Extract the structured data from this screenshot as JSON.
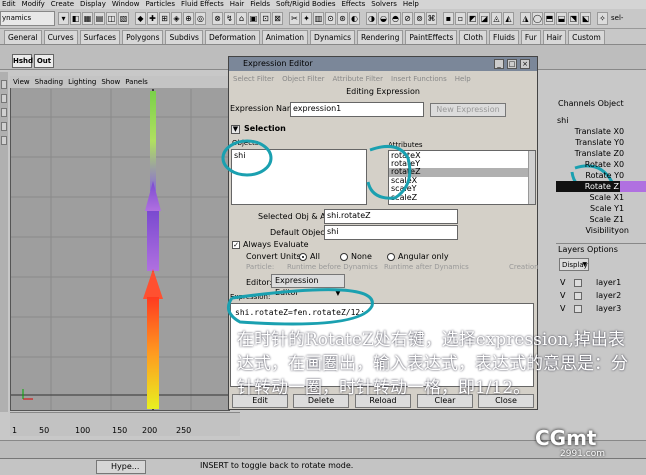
{
  "menubar": [
    "Edit",
    "Modify",
    "Create",
    "Display",
    "Window",
    "Particles",
    "Fluid Effects",
    "Hair",
    "Fields",
    "Soft/Rigid Bodies",
    "Effects",
    "Solvers",
    "Help"
  ],
  "mode": "ynamics",
  "status_right": "sel-",
  "shelf_tabs": [
    "General",
    "Curves",
    "Surfaces",
    "Polygons",
    "Subdivs",
    "Deformation",
    "Animation",
    "Dynamics",
    "Rendering",
    "PaintEffects",
    "Cloth",
    "Fluids",
    "Fur",
    "Hair",
    "Custom"
  ],
  "shelf_buttons": [
    "Hshd",
    "Out"
  ],
  "viewport": {
    "menu": [
      "View",
      "Shading",
      "Lighting",
      "Show",
      "Panels"
    ]
  },
  "timeline": {
    "ticks": [
      "1",
      "50",
      "100",
      "150",
      "200",
      "250"
    ]
  },
  "expression_editor": {
    "title": "Expression Editor",
    "menu": [
      "Select Filter",
      "Object Filter",
      "Attribute Filter",
      "Insert Functions",
      "Help"
    ],
    "heading": "Editing Expression",
    "name_label": "Expression Name",
    "name_value": "expression1",
    "new_expression": "New Expression",
    "selection_label": "Selection",
    "objects_label": "Objects",
    "attributes_label": "Attributes",
    "objects": [
      "shi"
    ],
    "attributes": [
      "rotateX",
      "rotateY",
      "rotateZ",
      "scaleX",
      "scaleY",
      "scaleZ"
    ],
    "selected_attribute": "rotateZ",
    "selected_obj_attr_label": "Selected Obj & Attr",
    "selected_obj_attr": "shi.rotateZ",
    "default_object_label": "Default Object",
    "default_object": "shi",
    "always_evaluate": "Always Evaluate",
    "convert_units_label": "Convert Units:",
    "convert_all": "All",
    "convert_none": "None",
    "convert_angular": "Angular only",
    "particle_label": "Particle:",
    "particle_runtime_before": "Runtime before Dynamics",
    "particle_runtime_after": "Runtime after Dynamics",
    "particle_creation": "Creation",
    "editor_label": "Editor:",
    "editor_value": "Expression Editor",
    "expression_label": "Expression:",
    "expression_text": "shi.rotateZ=fen.rotateZ/12;",
    "buttons": [
      "Edit",
      "Delete",
      "Reload",
      "Clear",
      "Close"
    ]
  },
  "channel_box": {
    "header": [
      "Channels",
      "Object"
    ],
    "object": "shi",
    "channels": [
      {
        "name": "Translate X",
        "value": "0"
      },
      {
        "name": "Translate Y",
        "value": "0"
      },
      {
        "name": "Translate Z",
        "value": "0"
      },
      {
        "name": "Rotate X",
        "value": "0"
      },
      {
        "name": "Rotate Y",
        "value": "0"
      },
      {
        "name": "Rotate Z",
        "value": ""
      },
      {
        "name": "Scale X",
        "value": "1"
      },
      {
        "name": "Scale Y",
        "value": "1"
      },
      {
        "name": "Scale Z",
        "value": "1"
      },
      {
        "name": "Visibility",
        "value": "on"
      }
    ]
  },
  "layers": {
    "header": [
      "Layers",
      "Options"
    ],
    "display": "Display",
    "items": [
      {
        "v": "V",
        "name": "layer1"
      },
      {
        "v": "V",
        "name": "layer2"
      },
      {
        "v": "V",
        "name": "layer3"
      }
    ]
  },
  "taskbar": [
    "Hype..."
  ],
  "help_line": "INSERT to toggle back to rotate mode.",
  "caption": "在时针的RotateZ处右键，选择expression,掉出表达式，在画圈出，输入表达式，表达式的意思是：分针转动一圈，时针转动一格，即1/12。",
  "watermark": "CGmt",
  "watermark_sub": "2991.com"
}
